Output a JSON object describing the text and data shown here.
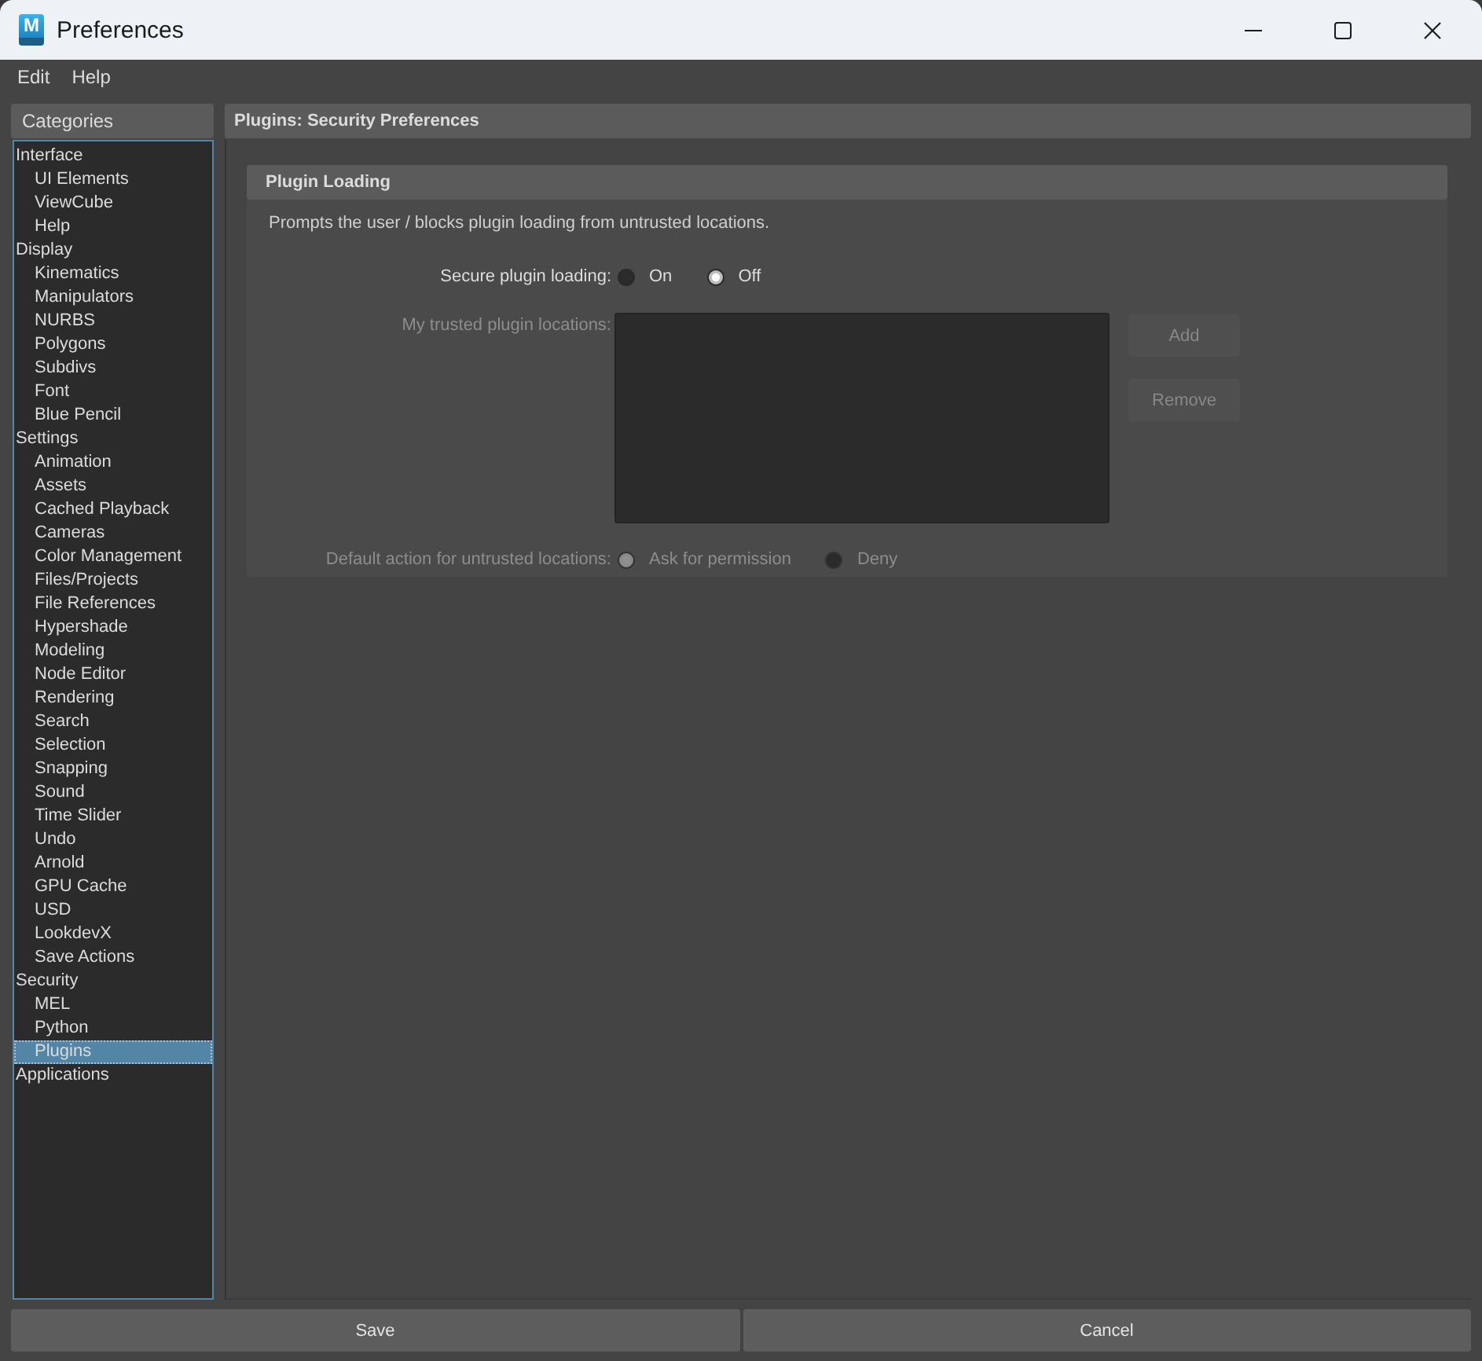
{
  "window": {
    "title": "Preferences",
    "logo_letter": "M"
  },
  "menu": [
    {
      "label": "Edit"
    },
    {
      "label": "Help"
    }
  ],
  "categories": {
    "title": "Categories",
    "items": [
      {
        "label": "Interface",
        "selected": false,
        "children": [
          {
            "label": "UI Elements",
            "selected": false
          },
          {
            "label": "ViewCube",
            "selected": false
          },
          {
            "label": "Help",
            "selected": false
          }
        ]
      },
      {
        "label": "Display",
        "selected": false,
        "children": [
          {
            "label": "Kinematics",
            "selected": false
          },
          {
            "label": "Manipulators",
            "selected": false
          },
          {
            "label": "NURBS",
            "selected": false
          },
          {
            "label": "Polygons",
            "selected": false
          },
          {
            "label": "Subdivs",
            "selected": false
          },
          {
            "label": "Font",
            "selected": false
          },
          {
            "label": "Blue Pencil",
            "selected": false
          }
        ]
      },
      {
        "label": "Settings",
        "selected": false,
        "children": [
          {
            "label": "Animation",
            "selected": false
          },
          {
            "label": "Assets",
            "selected": false
          },
          {
            "label": "Cached Playback",
            "selected": false
          },
          {
            "label": "Cameras",
            "selected": false
          },
          {
            "label": "Color Management",
            "selected": false
          },
          {
            "label": "Files/Projects",
            "selected": false
          },
          {
            "label": "File References",
            "selected": false
          },
          {
            "label": "Hypershade",
            "selected": false
          },
          {
            "label": "Modeling",
            "selected": false
          },
          {
            "label": "Node Editor",
            "selected": false
          },
          {
            "label": "Rendering",
            "selected": false
          },
          {
            "label": "Search",
            "selected": false
          },
          {
            "label": "Selection",
            "selected": false
          },
          {
            "label": "Snapping",
            "selected": false
          },
          {
            "label": "Sound",
            "selected": false
          },
          {
            "label": "Time Slider",
            "selected": false
          },
          {
            "label": "Undo",
            "selected": false
          },
          {
            "label": "Arnold",
            "selected": false
          },
          {
            "label": "GPU Cache",
            "selected": false
          },
          {
            "label": "USD",
            "selected": false
          },
          {
            "label": "LookdevX",
            "selected": false
          },
          {
            "label": "Save Actions",
            "selected": false
          }
        ]
      },
      {
        "label": "Security",
        "selected": false,
        "children": [
          {
            "label": "MEL",
            "selected": false
          },
          {
            "label": "Python",
            "selected": false
          },
          {
            "label": "Plugins",
            "selected": true
          }
        ]
      },
      {
        "label": "Applications",
        "selected": false
      }
    ]
  },
  "panel": {
    "title": "Plugins: Security Preferences",
    "section": {
      "title": "Plugin Loading",
      "description": "Prompts the user / blocks plugin loading from untrusted locations.",
      "rows": [
        {
          "kind": "radio",
          "label": "Secure plugin loading:",
          "disabled": false,
          "options": [
            {
              "label": "On",
              "selected": false
            },
            {
              "label": "Off",
              "selected": true
            }
          ]
        },
        {
          "kind": "list",
          "label": "My trusted plugin locations:",
          "disabled": true,
          "buttons": [
            {
              "label": "Add",
              "disabled": true
            },
            {
              "label": "Remove",
              "disabled": true
            }
          ]
        },
        {
          "kind": "radio",
          "label": "Default action for untrusted locations:",
          "disabled": true,
          "options": [
            {
              "label": "Ask for permission",
              "selected": true
            },
            {
              "label": "Deny",
              "selected": false
            }
          ]
        }
      ]
    }
  },
  "buttons": [
    {
      "label": "Save"
    },
    {
      "label": "Cancel"
    }
  ]
}
